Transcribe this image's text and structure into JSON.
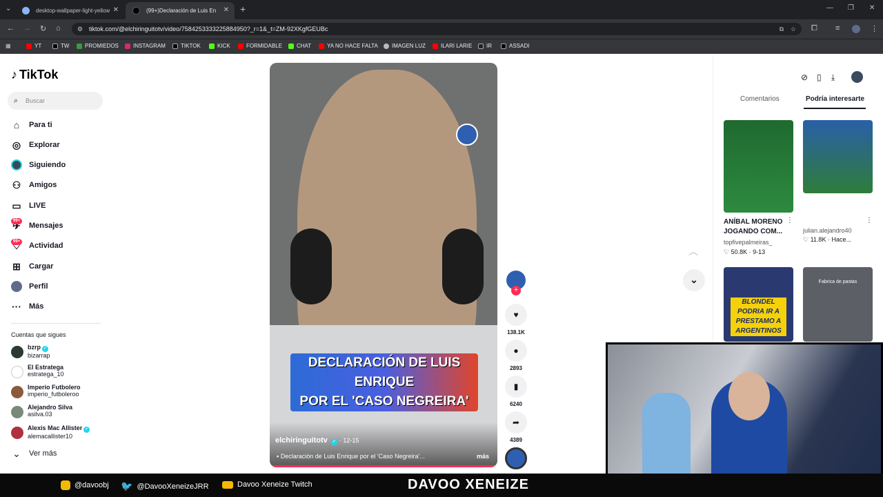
{
  "browser": {
    "tabs": [
      {
        "title": "desktop-wallpaper-light-yellow"
      },
      {
        "title": "(99+)Declaración de Luis En"
      }
    ],
    "url": "tiktok.com/@elchiringuitotv/video/7584253333225884950?_r=1&_t=ZM-92XKgfGEUBc",
    "bookmarks": [
      "YT",
      "TW",
      "PROMIEDOS",
      "INSTAGRAM",
      "TIKTOK",
      "KICK",
      "FORMIDABLE",
      "CHAT",
      "YA NO HACE FALTA",
      "IMAGEN LUZ",
      "ILARI LARIE",
      "IR",
      "ASSADI"
    ]
  },
  "tiktok": {
    "logo": "TikTok",
    "search_placeholder": "Buscar",
    "nav": [
      {
        "label": "Para ti",
        "icon": "home-icon"
      },
      {
        "label": "Explorar",
        "icon": "compass-icon"
      },
      {
        "label": "Siguiendo",
        "icon": "following-icon"
      },
      {
        "label": "Amigos",
        "icon": "friends-icon"
      },
      {
        "label": "LIVE",
        "icon": "live-icon"
      },
      {
        "label": "Mensajes",
        "icon": "messages-icon",
        "badge": "99+"
      },
      {
        "label": "Actividad",
        "icon": "activity-icon",
        "badge": "99+"
      },
      {
        "label": "Cargar",
        "icon": "upload-icon"
      },
      {
        "label": "Perfil",
        "icon": "profile-icon"
      },
      {
        "label": "Más",
        "icon": "more-icon"
      }
    ],
    "following_title": "Cuentas que sigues",
    "following": [
      {
        "name": "bzrp",
        "user": "bizarrap",
        "verified": true
      },
      {
        "name": "El Estratega",
        "user": "estratega_10",
        "verified": false
      },
      {
        "name": "Imperio Futbolero",
        "user": "imperio_futboleroo",
        "verified": false
      },
      {
        "name": "Alejandro Silva",
        "user": "asilva.03",
        "verified": false
      },
      {
        "name": "Alexis Mac Allister",
        "user": "alemacallister10",
        "verified": true
      }
    ],
    "see_more": "Ver más"
  },
  "video": {
    "overlay_line1": "DECLARACIÓN DE LUIS ENRIQUE",
    "overlay_line2": "POR EL 'CASO NEGREIRA'",
    "author": "elchiringuitotv",
    "date": "· 12-15",
    "description": "Declaración de Luis Enrique por el 'Caso Negreira'...",
    "more": "más",
    "likes": "138.1K",
    "comments": "2893",
    "saves": "6240",
    "shares": "4389"
  },
  "side": {
    "tabs": [
      "Comentarios",
      "Podría interesarte"
    ],
    "cards": [
      {
        "caption1": "ANÍBAL MORENO",
        "caption2": "JOGANDO COM...",
        "user": "topfivepalmeiras_",
        "likes": "50.8K",
        "date": "9-13"
      },
      {
        "caption1": "",
        "caption2": "",
        "user": "julian.alejandro40",
        "likes": "11.8K",
        "date": "Hace..."
      },
      {
        "thumb_text": "BLONDEL PODRIA IR A PRESTAMO A ARGENTINOS"
      },
      {
        "thumb_text": "Fabrica de pastas"
      }
    ]
  },
  "banner": {
    "instagram": "@davoobj",
    "twitter": "@DavooXeneizeJRR",
    "twitch": "Davoo Xeneize Twitch",
    "name": "DAVOO XENEIZE"
  },
  "colors": {
    "accent": "#fe2c55",
    "verified": "#20d5ec",
    "chrome_dark": "#202124"
  }
}
